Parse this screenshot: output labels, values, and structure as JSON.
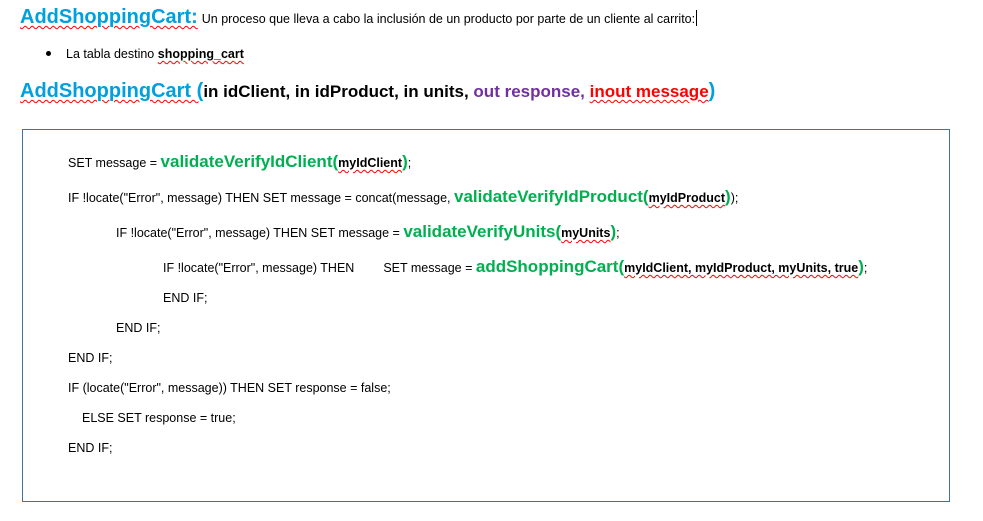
{
  "header": {
    "title": "AddShoppingCart:",
    "description": "Un proceso que lleva a cabo la inclusión de un producto por  parte de un cliente al carrito:"
  },
  "bullet": {
    "label": "La tabla destino ",
    "table": "shopping_cart"
  },
  "signature": {
    "name": "AddShoppingCart (",
    "p1": "in idClient, in idProduct, in units, ",
    "p2": "out response, ",
    "p3": "inout message",
    "close": ")"
  },
  "code": {
    "l1_a": "SET message = ",
    "l1_fn": "validateVerifyIdClient(",
    "l1_arg": "myIdClient",
    "l1_close": ")",
    "l1_end": ";",
    "l2_a": "IF  !locate(\"Error\", message) THEN SET message = concat(message,  ",
    "l2_fn": "validateVerifyIdProduct(",
    "l2_arg": "myIdProduct",
    "l2_close": ")",
    "l2_end": ");",
    "l3_a": "IF  !locate(\"Error\", message) THEN SET message = ",
    "l3_fn": "validateVerifyUnits(",
    "l3_arg": "myUnits",
    "l3_close": ")",
    "l3_end": ";",
    "l4_a": "IF  !locate(\"Error\", message)  THEN",
    "l4_b": "SET message = ",
    "l4_fn": "addShoppingCart(",
    "l4_arg": "myIdClient, myIdProduct, myUnits, true",
    "l4_close": ")",
    "l4_end": ";",
    "l5": "END IF;",
    "l6": "END IF;",
    "l7": "END IF;",
    "l8": "IF (locate(\"Error\", message)) THEN  SET response = false;",
    "l9": "ELSE SET response = true;",
    "l10": "END IF;"
  },
  "colors": {
    "heading": "#00a0e0",
    "function": "#00b050",
    "out_param": "#7030a0",
    "inout_param": "#ff0000",
    "box_border": "#41719c"
  }
}
